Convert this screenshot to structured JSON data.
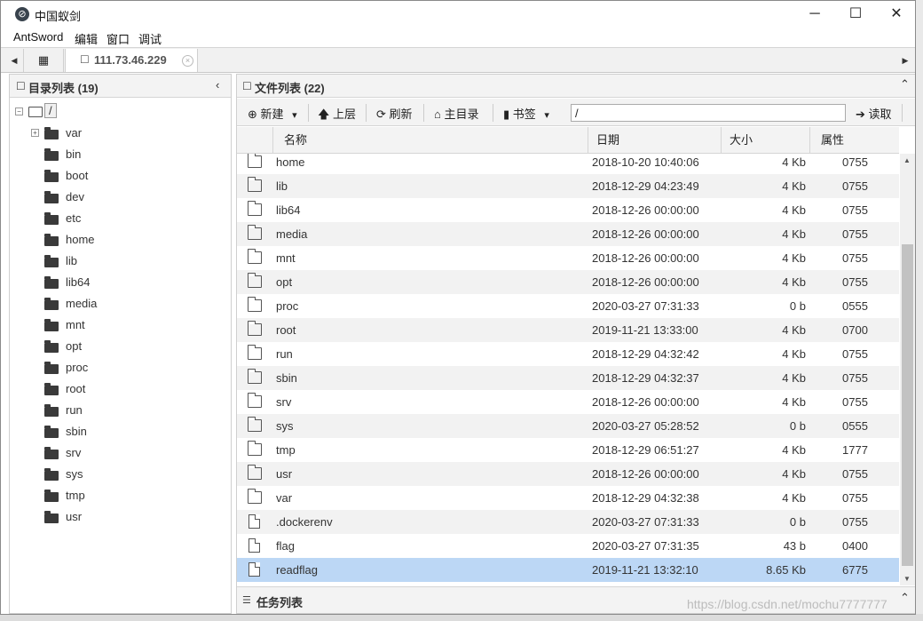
{
  "window": {
    "title": "中国蚁剑",
    "icon": "antsword-logo-icon",
    "controls": [
      "─",
      "☐",
      "✕"
    ]
  },
  "menu": [
    "AntSword",
    "编辑",
    "窗口",
    "调试"
  ],
  "tabs": {
    "home_icon": "▦",
    "host_icon": "☐",
    "host_label": "111.73.46.229",
    "close_icon": "×",
    "left_arrow": "◀",
    "right_arrow": "▶"
  },
  "dir_panel": {
    "icon": "☐",
    "title": "目录列表 (19)",
    "collapse": "‹",
    "root_expander": "−",
    "root": "/",
    "child_expander": "+",
    "items": [
      "var",
      "bin",
      "boot",
      "dev",
      "etc",
      "home",
      "lib",
      "lib64",
      "media",
      "mnt",
      "opt",
      "proc",
      "root",
      "run",
      "sbin",
      "srv",
      "sys",
      "tmp",
      "usr"
    ]
  },
  "file_panel": {
    "icon": "☐",
    "title": "文件列表 (22)",
    "collapse": "⌃",
    "toolbar": {
      "new_label": "新建",
      "new_icon": "⊕",
      "dropdown_caret": "▾",
      "up_label": "上层",
      "up_icon": "🡅",
      "refresh_label": "刷新",
      "refresh_icon": "⟳",
      "home_label": "主目录",
      "home_icon": "⌂",
      "bookmark_label": "书签",
      "bookmark_icon": "▮",
      "path_value": "/",
      "read_label": "读取",
      "read_icon": "➔"
    },
    "columns": [
      "名称",
      "日期",
      "大小",
      "属性"
    ],
    "rows": [
      {
        "type": "dir",
        "name": "home",
        "date": "2018-10-20 10:40:06",
        "size": "4 Kb",
        "attr": "0755"
      },
      {
        "type": "dir",
        "name": "lib",
        "date": "2018-12-29 04:23:49",
        "size": "4 Kb",
        "attr": "0755"
      },
      {
        "type": "dir",
        "name": "lib64",
        "date": "2018-12-26 00:00:00",
        "size": "4 Kb",
        "attr": "0755"
      },
      {
        "type": "dir",
        "name": "media",
        "date": "2018-12-26 00:00:00",
        "size": "4 Kb",
        "attr": "0755"
      },
      {
        "type": "dir",
        "name": "mnt",
        "date": "2018-12-26 00:00:00",
        "size": "4 Kb",
        "attr": "0755"
      },
      {
        "type": "dir",
        "name": "opt",
        "date": "2018-12-26 00:00:00",
        "size": "4 Kb",
        "attr": "0755"
      },
      {
        "type": "dir",
        "name": "proc",
        "date": "2020-03-27 07:31:33",
        "size": "0 b",
        "attr": "0555"
      },
      {
        "type": "dir",
        "name": "root",
        "date": "2019-11-21 13:33:00",
        "size": "4 Kb",
        "attr": "0700"
      },
      {
        "type": "dir",
        "name": "run",
        "date": "2018-12-29 04:32:42",
        "size": "4 Kb",
        "attr": "0755"
      },
      {
        "type": "dir",
        "name": "sbin",
        "date": "2018-12-29 04:32:37",
        "size": "4 Kb",
        "attr": "0755"
      },
      {
        "type": "dir",
        "name": "srv",
        "date": "2018-12-26 00:00:00",
        "size": "4 Kb",
        "attr": "0755"
      },
      {
        "type": "dir",
        "name": "sys",
        "date": "2020-03-27 05:28:52",
        "size": "0 b",
        "attr": "0555"
      },
      {
        "type": "dir",
        "name": "tmp",
        "date": "2018-12-29 06:51:27",
        "size": "4 Kb",
        "attr": "1777"
      },
      {
        "type": "dir",
        "name": "usr",
        "date": "2018-12-26 00:00:00",
        "size": "4 Kb",
        "attr": "0755"
      },
      {
        "type": "dir",
        "name": "var",
        "date": "2018-12-29 04:32:38",
        "size": "4 Kb",
        "attr": "0755"
      },
      {
        "type": "file",
        "name": ".dockerenv",
        "date": "2020-03-27 07:31:33",
        "size": "0 b",
        "attr": "0755"
      },
      {
        "type": "file",
        "name": "flag",
        "date": "2020-03-27 07:31:35",
        "size": "43 b",
        "attr": "0400"
      },
      {
        "type": "file",
        "name": "readflag",
        "date": "2019-11-21 13:32:10",
        "size": "8.65 Kb",
        "attr": "6775",
        "selected": true
      }
    ],
    "scroll_up": "▲",
    "scroll_down": "▼"
  },
  "task_panel": {
    "icon": "☰",
    "title": "任务列表",
    "collapse": "⌃"
  },
  "watermark": "https://blog.csdn.net/mochu7777777",
  "colors": {
    "selected_row": "#bcd7f5",
    "alt_row": "#f2f2f2",
    "panel_header": "#f3f3f3"
  }
}
